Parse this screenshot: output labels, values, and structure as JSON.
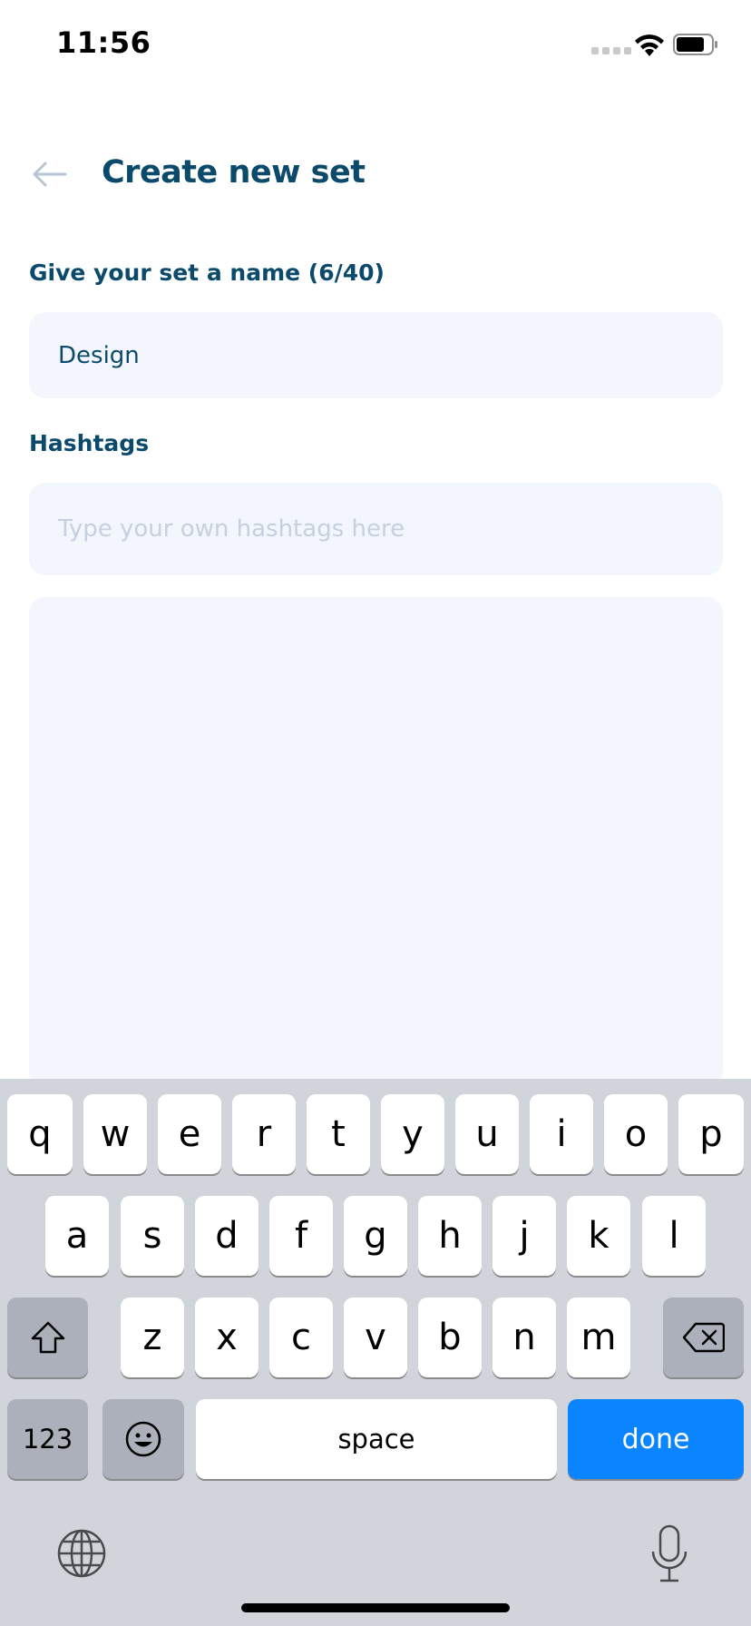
{
  "status_bar": {
    "time": "11:56"
  },
  "header": {
    "title": "Create new set",
    "back_icon": "arrow-left-icon"
  },
  "form": {
    "name_label": "Give your set a name (6/40)",
    "name_value": "Design",
    "hashtags_label": "Hashtags",
    "hashtags_placeholder": "Type your own hashtags here"
  },
  "keyboard": {
    "row1": [
      "q",
      "w",
      "e",
      "r",
      "t",
      "y",
      "u",
      "i",
      "o",
      "p"
    ],
    "row2": [
      "a",
      "s",
      "d",
      "f",
      "g",
      "h",
      "j",
      "k",
      "l"
    ],
    "row3": [
      "z",
      "x",
      "c",
      "v",
      "b",
      "n",
      "m"
    ],
    "numbers_label": "123",
    "space_label": "space",
    "done_label": "done"
  },
  "colors": {
    "title": "#0b4a6b",
    "input_bg": "#f3f6fd",
    "done_button": "#0a84ff",
    "keyboard_bg": "#d1d5db"
  }
}
